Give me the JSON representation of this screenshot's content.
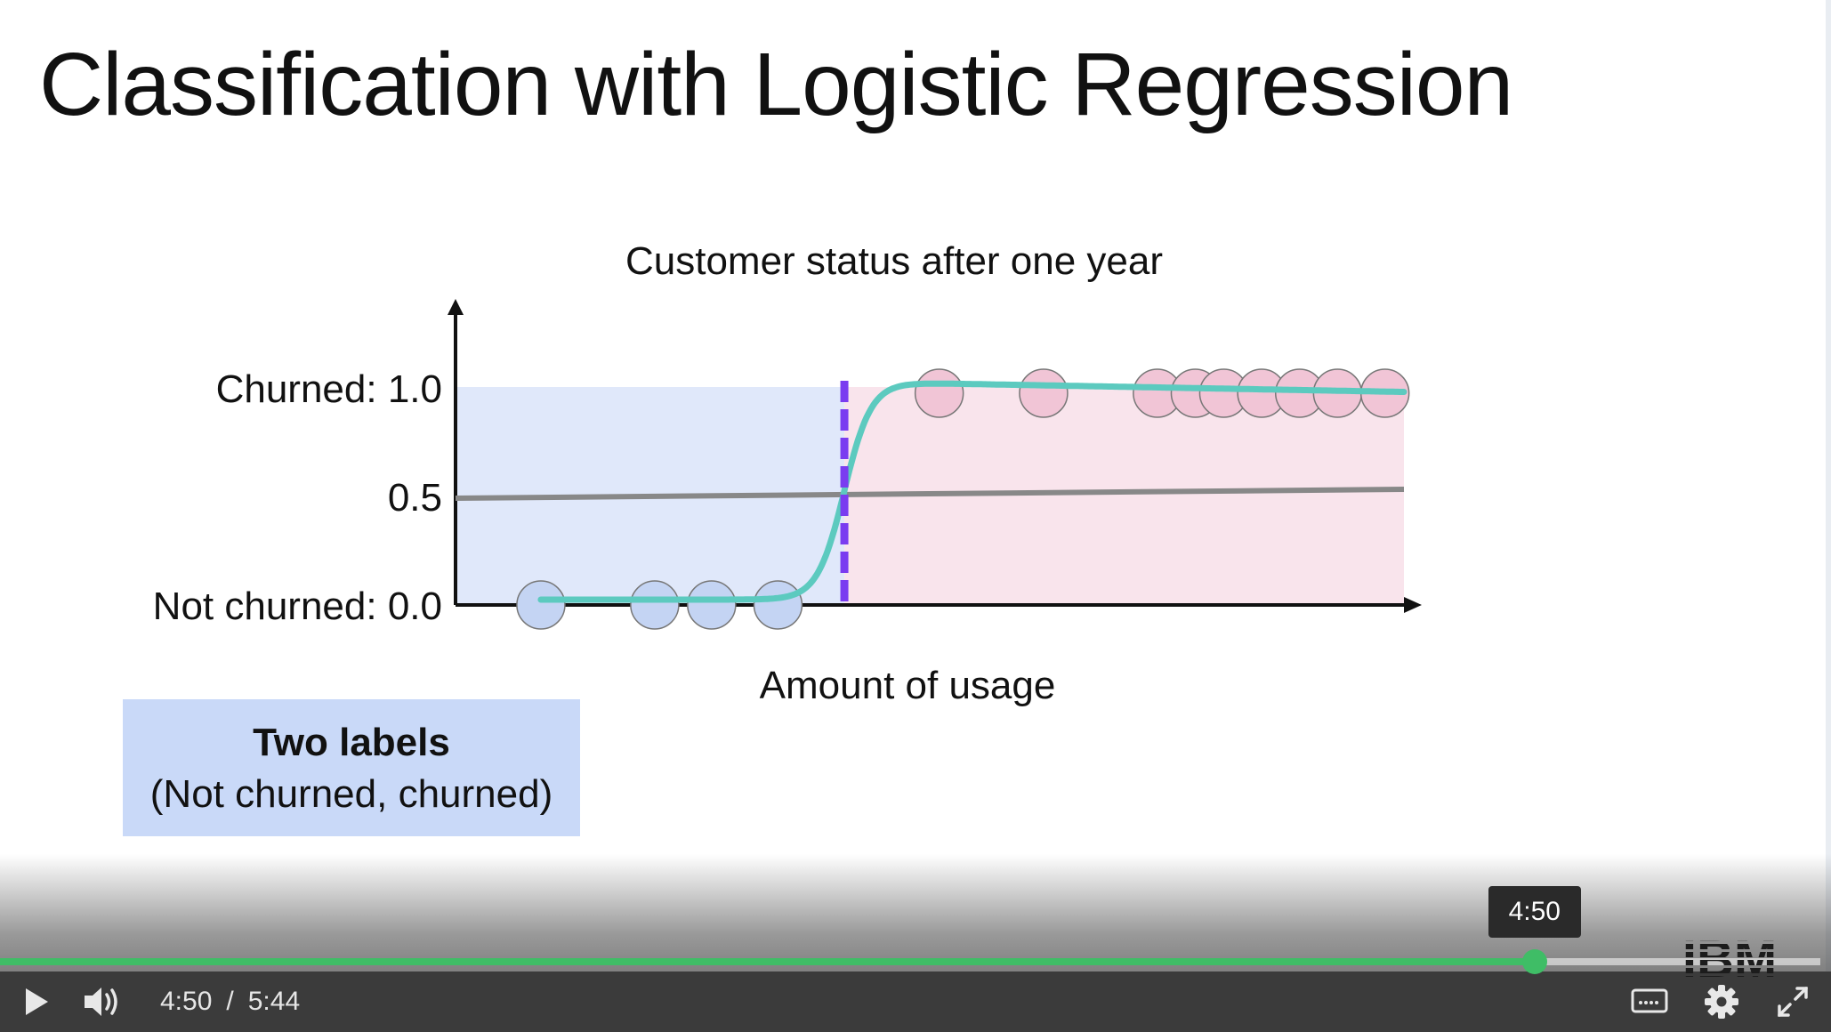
{
  "slide": {
    "title": "Classification with Logistic Regression",
    "label_box": {
      "line1": "Two labels",
      "line2": "(Not churned, churned)"
    }
  },
  "chart_data": {
    "type": "scatter",
    "title": "Customer status after one year",
    "xlabel": "Amount of usage",
    "ylabel": "",
    "y_ticks": [
      {
        "value": 1.0,
        "label": "Churned: 1.0"
      },
      {
        "value": 0.5,
        "label": "0.5"
      },
      {
        "value": 0.0,
        "label": "Not churned: 0.0"
      }
    ],
    "xlim": [
      0,
      10
    ],
    "ylim": [
      0,
      1.2
    ],
    "decision_threshold_x": 4.1,
    "threshold_y": 0.5,
    "regions": [
      {
        "name": "Not churned",
        "x_range": [
          0,
          4.1
        ],
        "color": "#e0e8fa"
      },
      {
        "name": "Churned",
        "x_range": [
          4.1,
          10
        ],
        "color": "#f9e4ec"
      }
    ],
    "series": [
      {
        "values_x": [
          0.9,
          2.1,
          2.7,
          3.4
        ],
        "values_y": [
          0,
          0,
          0,
          0
        ],
        "color": "#c4d4f3"
      },
      {
        "values_x": [
          5.1,
          6.2,
          7.4,
          7.8,
          8.1,
          8.5,
          8.9,
          9.3,
          9.8
        ],
        "values_y": [
          1,
          1,
          1,
          1,
          1,
          1,
          1,
          1,
          1
        ],
        "color": "#f1c5d6"
      }
    ],
    "curve_color": "#5ccabf",
    "threshold_line_color": "#888888",
    "decision_line_color": "#7a3cf0"
  },
  "player": {
    "current_time": "4:50",
    "separator": "/",
    "duration": "5:44",
    "tooltip_time": "4:50",
    "progress": 0.843,
    "accent_color": "#3fbd66",
    "icons": {
      "play": "play-icon",
      "volume": "volume-icon",
      "captions": "captions-icon",
      "settings": "gear-icon",
      "fullscreen": "fullscreen-icon"
    },
    "logo": "IBM"
  }
}
